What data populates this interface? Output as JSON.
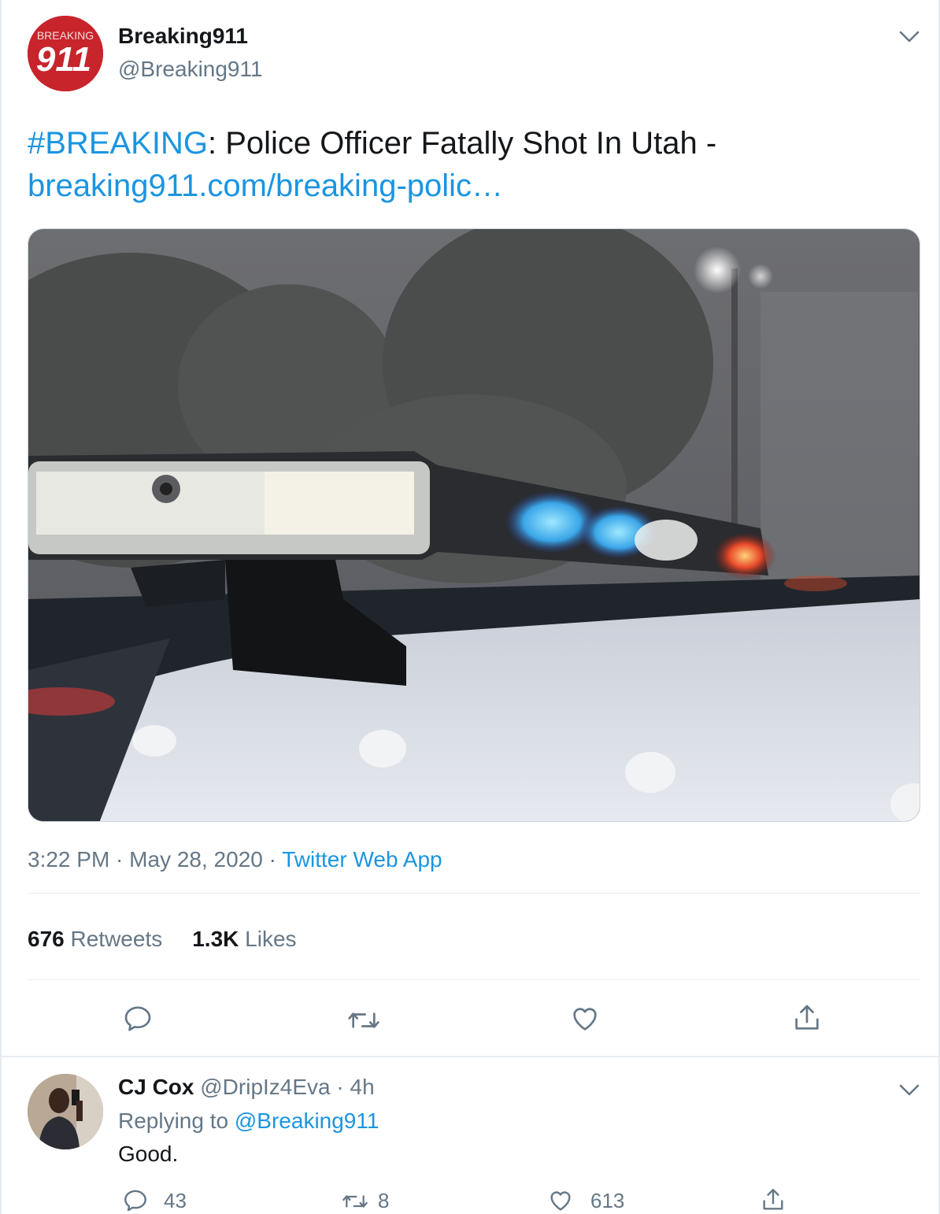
{
  "author": {
    "avatar_icon": "breaking911-logo-icon",
    "logo_text_top": "BREAKING",
    "logo_text_main": "911",
    "display_name": "Breaking911",
    "handle": "@Breaking911"
  },
  "tweet": {
    "hashtag": "#BREAKING",
    "text_after_hashtag": ": Police Officer Fatally Shot In Utah -",
    "link_text": "breaking911.com/breaking-polic…",
    "time": "3:22 PM",
    "sep1": " · ",
    "date": "May 28, 2020",
    "sep2": " · ",
    "source": "Twitter Web App"
  },
  "stats": {
    "retweets_count": "676",
    "retweets_label": "Retweets",
    "likes_count": "1.3K",
    "likes_label": "Likes"
  },
  "actions": [
    "reply-icon",
    "retweet-icon",
    "like-icon",
    "share-icon"
  ],
  "reply": {
    "display_name": "CJ Cox",
    "handle": "@DripIz4Eva",
    "sep": " · ",
    "time": "4h",
    "replying_prefix": "Replying to",
    "replying_handle": "@Breaking911",
    "text": "Good.",
    "reply_count": "43",
    "retweet_count": "8",
    "like_count": "613"
  },
  "colors": {
    "link": "#1b95e0",
    "secondary_text": "#657786",
    "divider": "#e6ecf0",
    "logo_red": "#c8242c"
  }
}
